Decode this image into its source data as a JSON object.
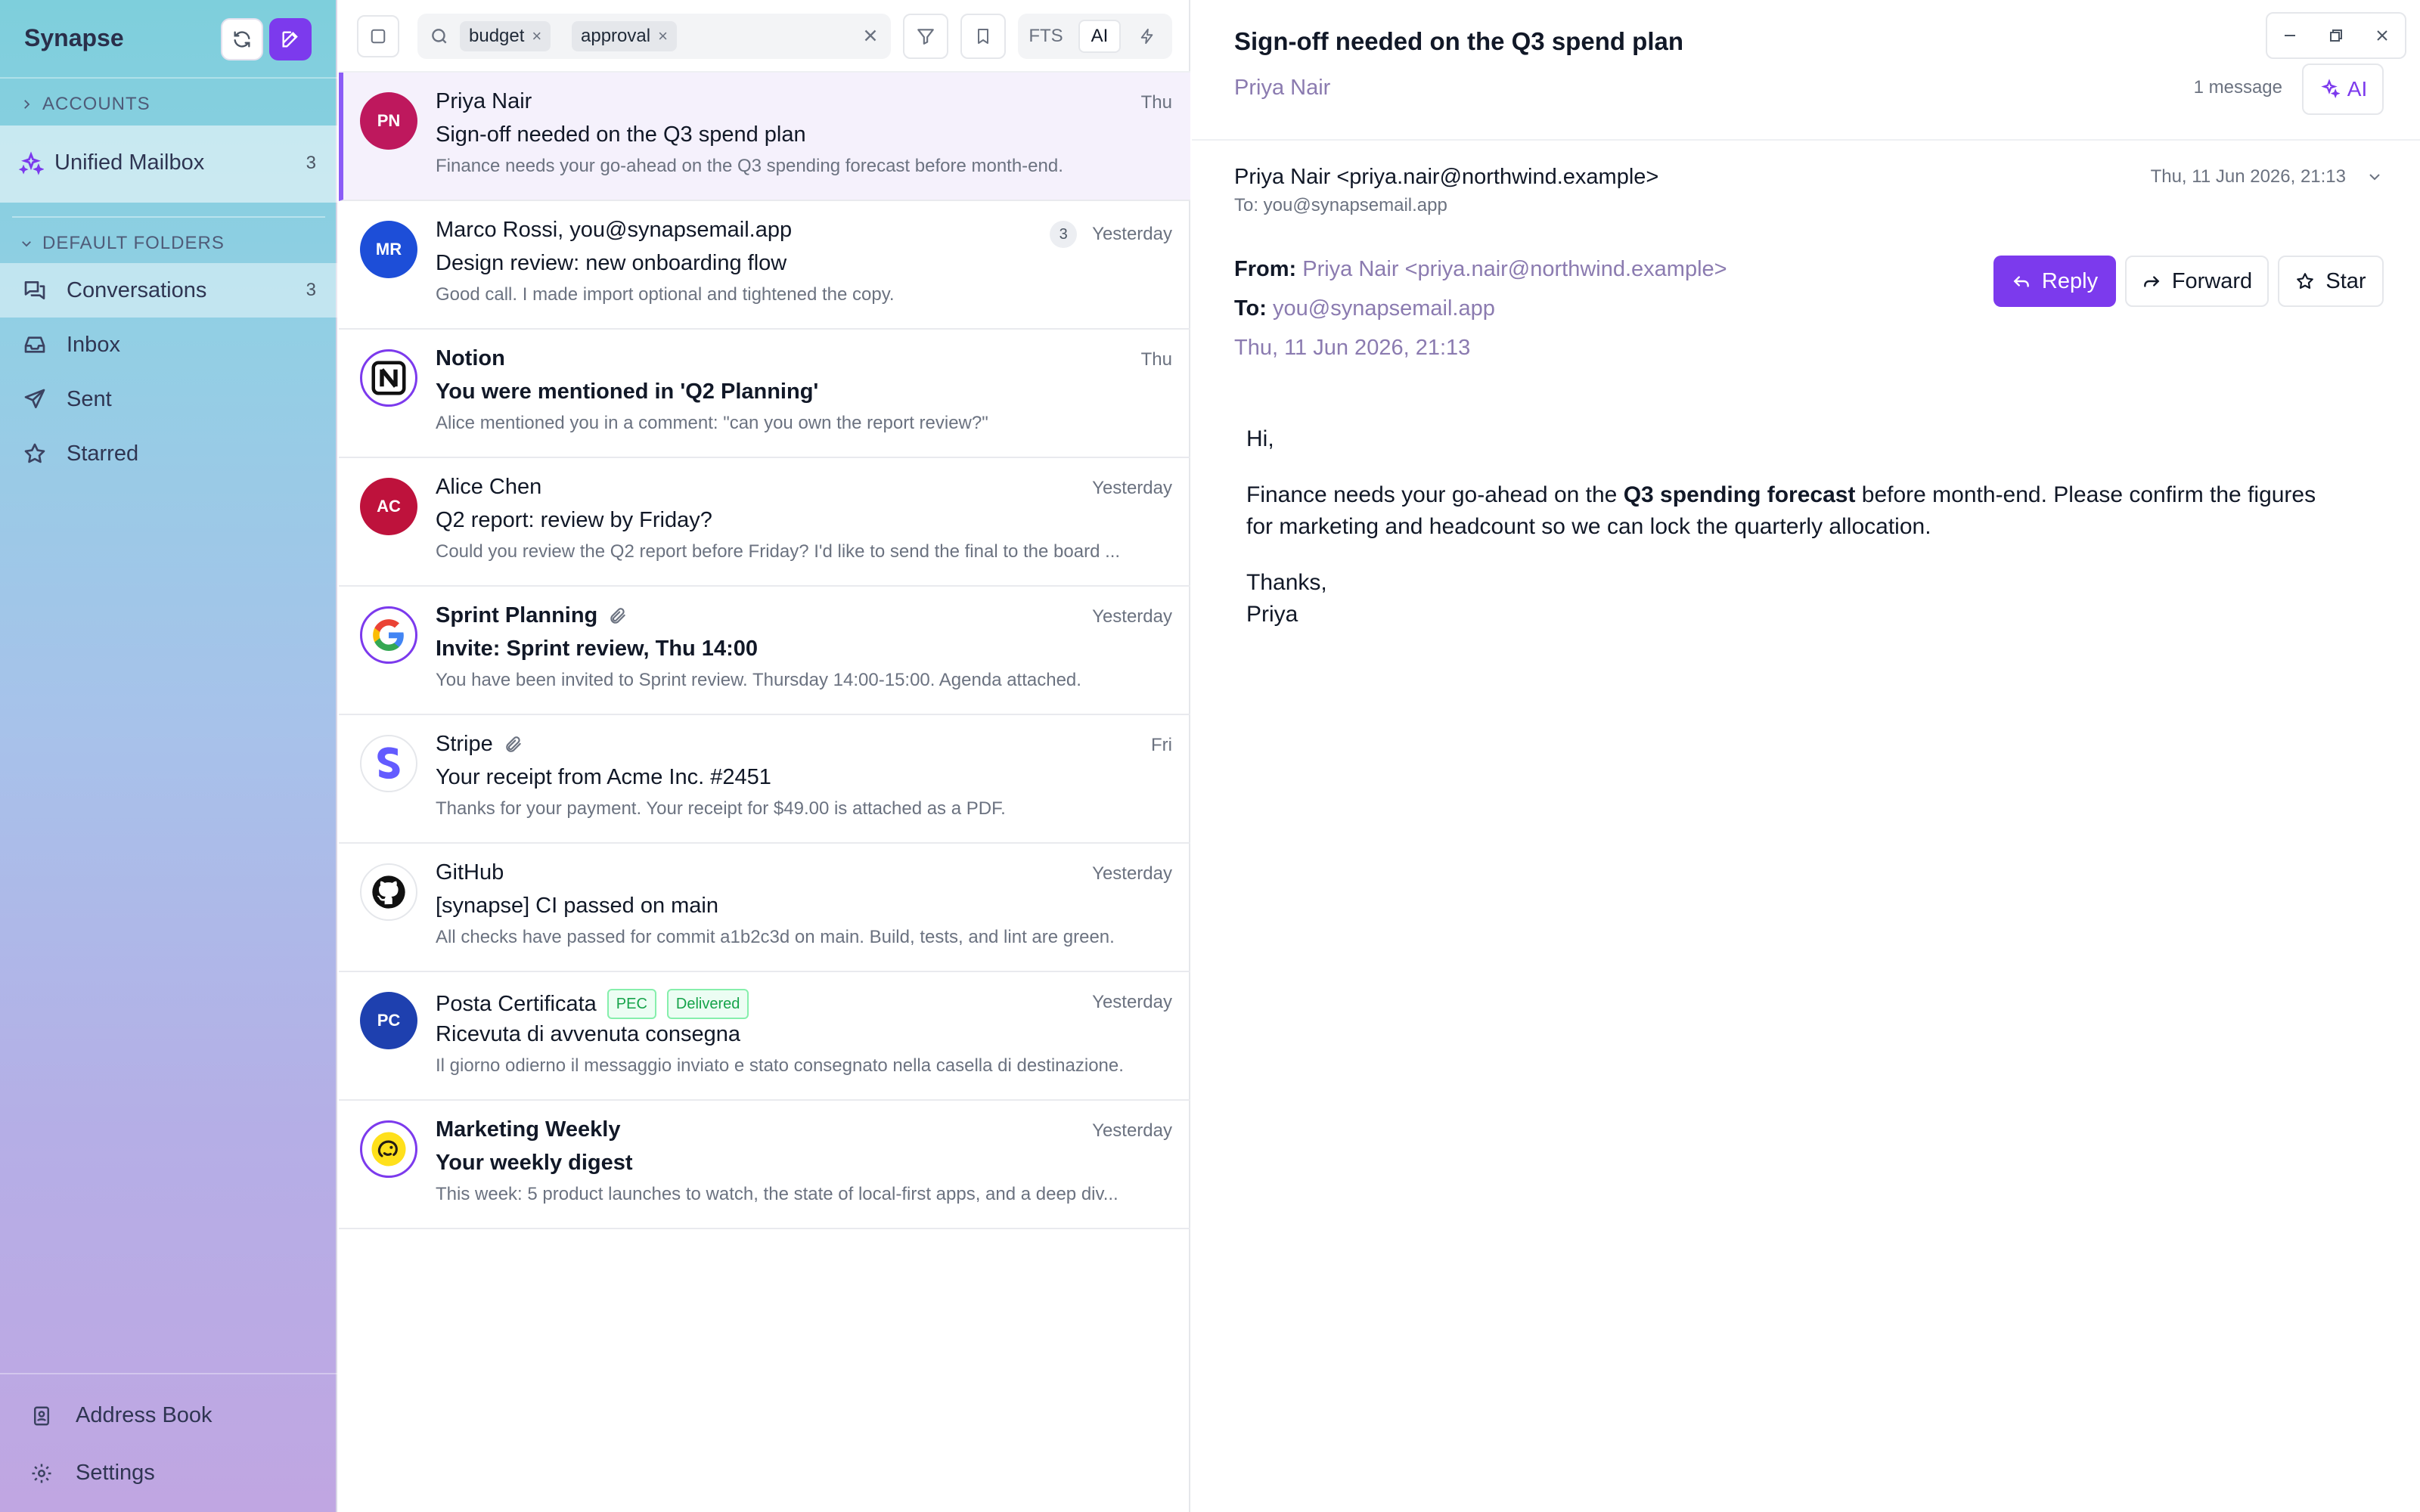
{
  "app": {
    "title": "Synapse"
  },
  "sidebar": {
    "accounts_label": "ACCOUNTS",
    "unified": {
      "label": "Unified Mailbox",
      "count": "3"
    },
    "default_folders_label": "DEFAULT FOLDERS",
    "folders": [
      {
        "label": "Conversations",
        "count": "3",
        "icon": "conversations-icon"
      },
      {
        "label": "Inbox",
        "count": "",
        "icon": "inbox-icon"
      },
      {
        "label": "Sent",
        "count": "",
        "icon": "send-icon"
      },
      {
        "label": "Starred",
        "count": "",
        "icon": "star-icon"
      }
    ],
    "footer": [
      {
        "label": "Address Book",
        "icon": "address-book-icon"
      },
      {
        "label": "Settings",
        "icon": "gear-icon"
      }
    ]
  },
  "toolbar": {
    "chips": [
      "budget",
      "approval"
    ],
    "seg_fts": "FTS",
    "seg_ai": "AI"
  },
  "messages": [
    {
      "sender": "Priya Nair",
      "subject": "Sign-off needed on the Q3 spend plan",
      "preview": "Finance needs your go-ahead on the Q3 spending forecast before month-end.",
      "date": "Thu",
      "initials": "PN"
    },
    {
      "sender": "Marco Rossi, you@synapsemail.app",
      "subject": "Design review: new onboarding flow",
      "preview": "Good call. I made import optional and tightened the copy.",
      "date": "Yesterday",
      "initials": "MR",
      "thread_count": "3"
    },
    {
      "sender": "Notion",
      "subject": "You were mentioned in 'Q2 Planning'",
      "preview": "Alice mentioned you in a comment: \"can you own the report review?\"",
      "date": "Thu",
      "initials": "N"
    },
    {
      "sender": "Alice Chen",
      "subject": "Q2 report: review by Friday?",
      "preview": "Could you review the Q2 report before Friday? I'd like to send the final to the board ...",
      "date": "Yesterday",
      "initials": "AC"
    },
    {
      "sender": "Sprint Planning",
      "subject": "Invite: Sprint review, Thu 14:00",
      "preview": "You have been invited to Sprint review. Thursday 14:00-15:00. Agenda attached.",
      "date": "Yesterday",
      "initials": "G"
    },
    {
      "sender": "Stripe",
      "subject": "Your receipt from Acme Inc. #2451",
      "preview": "Thanks for your payment. Your receipt for $49.00 is attached as a PDF.",
      "date": "Fri",
      "initials": "S"
    },
    {
      "sender": "GitHub",
      "subject": "[synapse] CI passed on main",
      "preview": "All checks have passed for commit a1b2c3d on main. Build, tests, and lint are green.",
      "date": "Yesterday"
    },
    {
      "sender": "Posta Certificata",
      "subject": "Ricevuta di avvenuta consegna",
      "preview": "Il giorno odierno il messaggio inviato e stato consegnato nella casella di destinazione.",
      "date": "Yesterday",
      "initials": "PC",
      "badges": [
        "PEC",
        "Delivered"
      ]
    },
    {
      "sender": "Marketing Weekly",
      "subject": "Your weekly digest",
      "preview": "This week: 5 product launches to watch, the state of local-first apps, and a deep div...",
      "date": "Yesterday"
    }
  ],
  "reader": {
    "subject": "Sign-off needed on the Q3 spend plan",
    "participant": "Priya Nair",
    "message_count": "1 message",
    "ai_label": "AI",
    "from_line": "Priya Nair <priya.nair@northwind.example>",
    "to_line": "To: you@synapsemail.app",
    "date_short": "Thu, 11 Jun 2026, 21:13",
    "from_label": "From:",
    "from_value": "Priya Nair <priya.nair@northwind.example>",
    "to_label": "To:",
    "to_value": "you@synapsemail.app",
    "date_full": "Thu, 11 Jun 2026, 21:13",
    "reply_label": "Reply",
    "forward_label": "Forward",
    "star_label": "Star",
    "body_greeting": "Hi,",
    "body_pre": "Finance needs your go-ahead on the ",
    "body_bold": "Q3 spending forecast",
    "body_post": " before month-end. Please confirm the figures for marketing and headcount so we can lock the quarterly allocation.",
    "body_thanks": "Thanks,",
    "body_sign": "Priya"
  },
  "colors": {
    "accent": "#7c3aed",
    "selected_row": "#f5f1fc",
    "avatar_pn": "#be185d",
    "avatar_mr": "#1d4ed8",
    "avatar_ac": "#be123c",
    "avatar_pc": "#1e40af"
  }
}
